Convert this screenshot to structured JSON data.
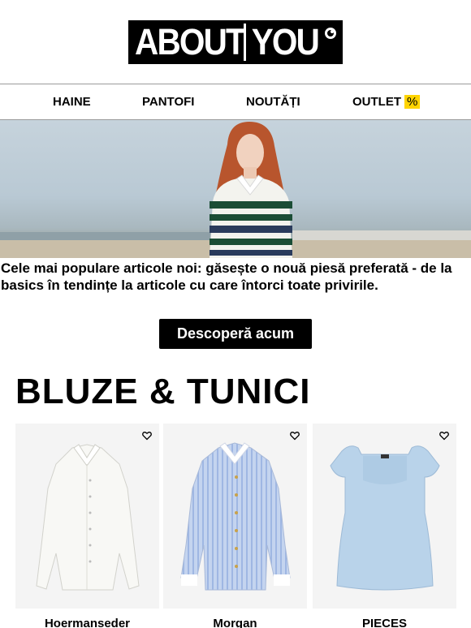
{
  "header": {
    "logo_text": "ABOUT YOU"
  },
  "nav": {
    "items": [
      {
        "label": "HAINE"
      },
      {
        "label": "PANTOFI"
      },
      {
        "label": "NOUTĂȚI"
      },
      {
        "label": "OUTLET",
        "badge": "%"
      }
    ]
  },
  "hero": {
    "intro_text": "Cele mai populare articole noi: găsește o nouă piesă preferată - de la basics în tendințe la articole cu care întorci toate privirile.",
    "cta_label": "Descoperă acum"
  },
  "section": {
    "title": "BLUZE & TUNICI",
    "products": [
      {
        "brand": "Hoermanseder",
        "icon": "heart-icon"
      },
      {
        "brand": "Morgan",
        "icon": "heart-icon"
      },
      {
        "brand": "PIECES",
        "icon": "heart-icon"
      }
    ]
  },
  "colors": {
    "accent": "#ffd400",
    "button_bg": "#000000",
    "card_bg": "#f4f4f4"
  }
}
